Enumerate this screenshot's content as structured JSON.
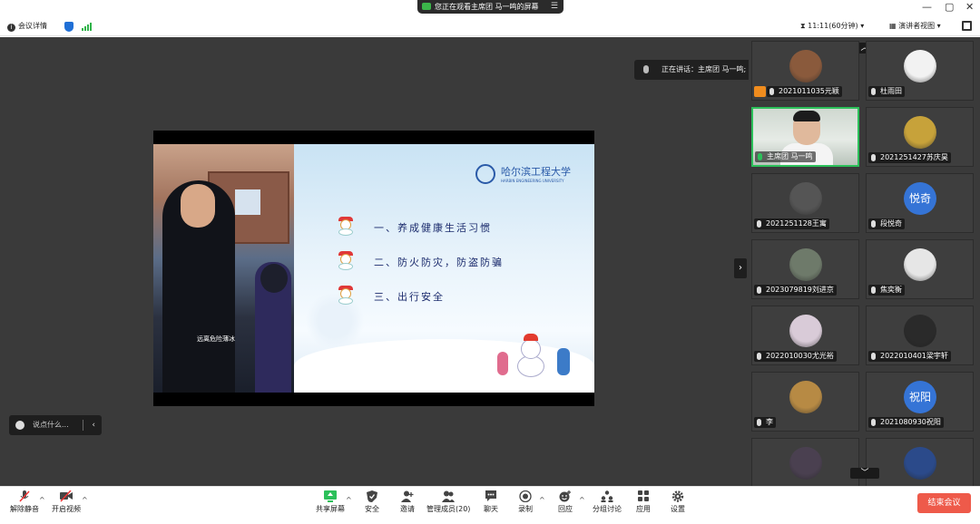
{
  "top": {
    "notice": "您正在观看主席团 马一鸣的屏幕",
    "meeting_info": "会议详情",
    "timer": "11:11(60分钟)",
    "view_mode": "演讲者视图",
    "window_controls": [
      "—",
      "▢",
      "✕"
    ]
  },
  "main": {
    "speaking": "正在讲话：主席团 马一鸣;",
    "video_caption": "远离危险薄冰",
    "slide": {
      "school_name": "哈尔滨工程大学",
      "school_sub": "HARBIN ENGINEERING UNIVERSITY",
      "items": [
        "一、养成健康生活习惯",
        "二、防火防灾，防盗防骗",
        "三、出行安全"
      ]
    },
    "chat_placeholder": "说点什么...",
    "chat_collapse": "‹",
    "side_toggle": "›"
  },
  "gallery": {
    "up": "︿",
    "down": "﹀",
    "tiles": [
      {
        "name": "2021011035元颖",
        "avatar": "photo",
        "color": "#8a5a3c",
        "host": true
      },
      {
        "name": "杜雨田",
        "avatar": "photo",
        "color": "#f2f2f2"
      },
      {
        "name": "主席团 马一鸣",
        "avatar": "camera",
        "active": true
      },
      {
        "name": "2021251427苏庆昊",
        "avatar": "photo",
        "color": "#c7a23a"
      },
      {
        "name": "2021251128王寓",
        "avatar": "photo",
        "color": "#555"
      },
      {
        "name": "段悦奇",
        "avatar": "text",
        "text": "悦奇"
      },
      {
        "name": "2023079819刘进京",
        "avatar": "photo",
        "color": "#6e7a6a"
      },
      {
        "name": "焦奕衡",
        "avatar": "photo",
        "color": "#e6e6e6"
      },
      {
        "name": "2022010030尤光裕",
        "avatar": "photo",
        "color": "#d9cbd8"
      },
      {
        "name": "2022010401梁宇轩",
        "avatar": "photo",
        "color": "#2a2a2a"
      },
      {
        "name": "李",
        "avatar": "photo",
        "color": "#b78a44"
      },
      {
        "name": "2021080930祝阳",
        "avatar": "text",
        "text": "祝阳"
      },
      {
        "name": "",
        "avatar": "photo",
        "color": "#4a4050"
      },
      {
        "name": "",
        "avatar": "photo",
        "color": "#2b4a8a"
      }
    ]
  },
  "toolbar": {
    "unmute": "解除静音",
    "start_video": "开启视频",
    "share_screen": "共享屏幕",
    "security": "安全",
    "invite": "邀请",
    "manage_members": "管理成员(20)",
    "chat": "聊天",
    "record": "录制",
    "reactions": "回应",
    "breakout": "分组讨论",
    "apps": "应用",
    "settings": "设置",
    "end_meeting": "结束会议",
    "caret": "^"
  },
  "colors": {
    "accent_green": "#2cc05a",
    "end_red": "#ee5a4a",
    "brand_blue": "#1f6fd6"
  }
}
